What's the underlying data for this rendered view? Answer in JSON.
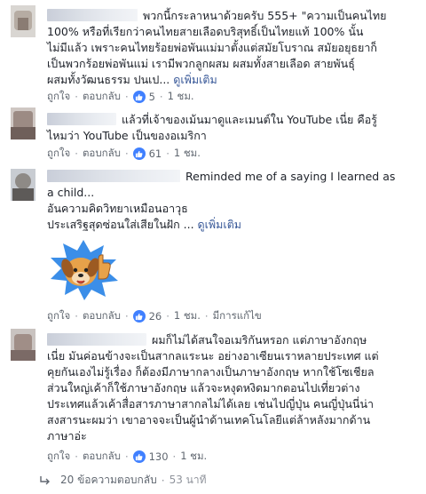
{
  "comments": [
    {
      "text_lines": [
        "พวกนี้กระลาหนาด้วยครับ 555+ \"ความเป็นคนไทย",
        "100% หรือที่เรียกว่าคนไทยสายเลือดบริสุทธิ์เป็นไทยแท้ 100% นั้น",
        "ไม่มีแล้ว เพราะคนไทยร้อยพ่อพันแม่มาตั้งแต่สมัยโบราณ สมัยอยุธยาก็",
        "เป็นพวกร้อยพ่อพันแม่ เรามีพวกลูกผสม ผสมทั้งสายเลือด สายพันธุ์",
        "ผสมทั้งวัฒนธรรม ปนเป..."
      ],
      "see_more": "ดูเพิ่มเติม",
      "like": "ถูกใจ",
      "reply": "ตอบกลับ",
      "like_count": "5",
      "time": "1 ชม.",
      "edited": ""
    },
    {
      "text_lines": [
        "แล้วที่เจ้าของเม้นมาดูและเมนต์ใน YouTube เนี่ย คือรู้",
        "ไหมว่า YouTube เป็นของอเมริกา"
      ],
      "see_more": "",
      "like": "ถูกใจ",
      "reply": "ตอบกลับ",
      "like_count": "61",
      "time": "1 ชม.",
      "edited": ""
    },
    {
      "text_lines": [
        "Reminded me of a saying I learned as",
        "a child...",
        "อันความคิดวิทยาเหมือนอาวุธ",
        "ประเสริฐสุดซ่อนใส่เสียในฝัก ..."
      ],
      "see_more": "ดูเพิ่มเติม",
      "like": "ถูกใจ",
      "reply": "ตอบกลับ",
      "like_count": "26",
      "time": "1 ชม.",
      "edited": "มีการแก้ไข",
      "sticker": "dog-thumbs-up-sticker"
    },
    {
      "text_lines": [
        "ผมก็ไม่ได้สนใจอเมริกันหรอก แต่ภาษาอังกฤษ",
        "เนี่ย มันค่อนข้างจะเป็นสากลแระนะ อย่างอาเซียนเราหลายประเทศ แต่",
        "คุยกันเองไม่รู้เรื่อง ก็ต้องมีภาษากลางเป็นภาษาอังกฤษ หากใช้โซเชียล",
        "ส่วนใหญ่เค้าก็ใช้ภาษาอังกฤษ แล้วจะหงุดหงิดมากตอนไปเที่ยวต่าง",
        "ประเทศแล้วเค้าสื่อสารภาษาสากลไม่ได้เลย เช่นไปญี่ปุ่น คนญี่ปุ่นนี่น่า",
        "สงสารนะผมว่า เขาอาจจะเป็นผู้นำด้านเทคโนโลยีแต่ล้าหลังมากด้าน",
        "ภาษาอ่ะ"
      ],
      "see_more": "",
      "like": "ถูกใจ",
      "reply": "ตอบกลับ",
      "like_count": "130",
      "time": "1 ชม.",
      "edited": ""
    }
  ],
  "replies_link": {
    "label": "20 ข้อความตอบกลับ",
    "time": "53 นาที"
  },
  "colors": {
    "link": "#385898",
    "meta": "#606770",
    "like_blue": "#4080ff",
    "sticker_burst": "#3b8ee8"
  }
}
